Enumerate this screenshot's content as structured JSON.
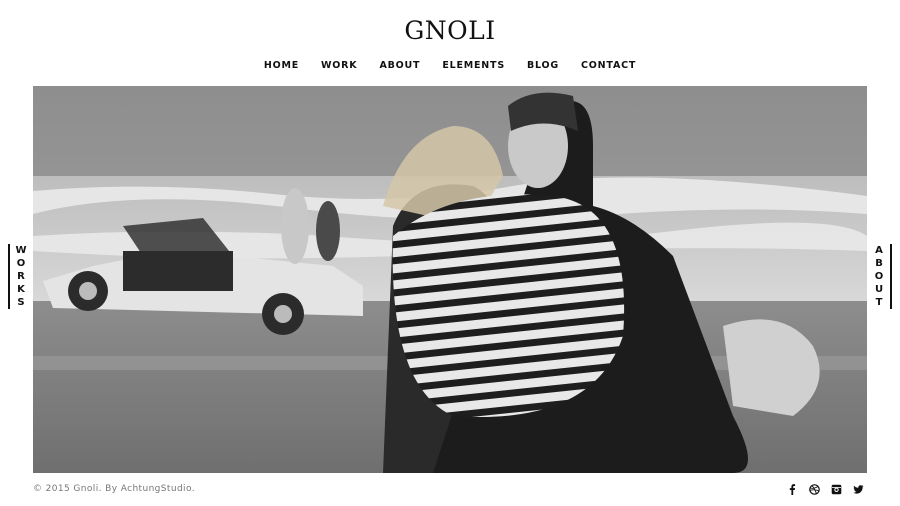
{
  "site": {
    "logo": "GNOLI"
  },
  "nav": {
    "items": [
      {
        "label": "HOME"
      },
      {
        "label": "WORK"
      },
      {
        "label": "ABOUT"
      },
      {
        "label": "ELEMENTS"
      },
      {
        "label": "BLOG"
      },
      {
        "label": "CONTACT"
      }
    ]
  },
  "side": {
    "left": [
      "W",
      "O",
      "R",
      "K",
      "S"
    ],
    "right": [
      "A",
      "B",
      "O",
      "U",
      "T"
    ]
  },
  "footer": {
    "copyright": "© 2015 Gnoli. By AchtungStudio."
  },
  "social": [
    "facebook-icon",
    "dribbble-icon",
    "instagram-icon",
    "twitter-icon"
  ]
}
